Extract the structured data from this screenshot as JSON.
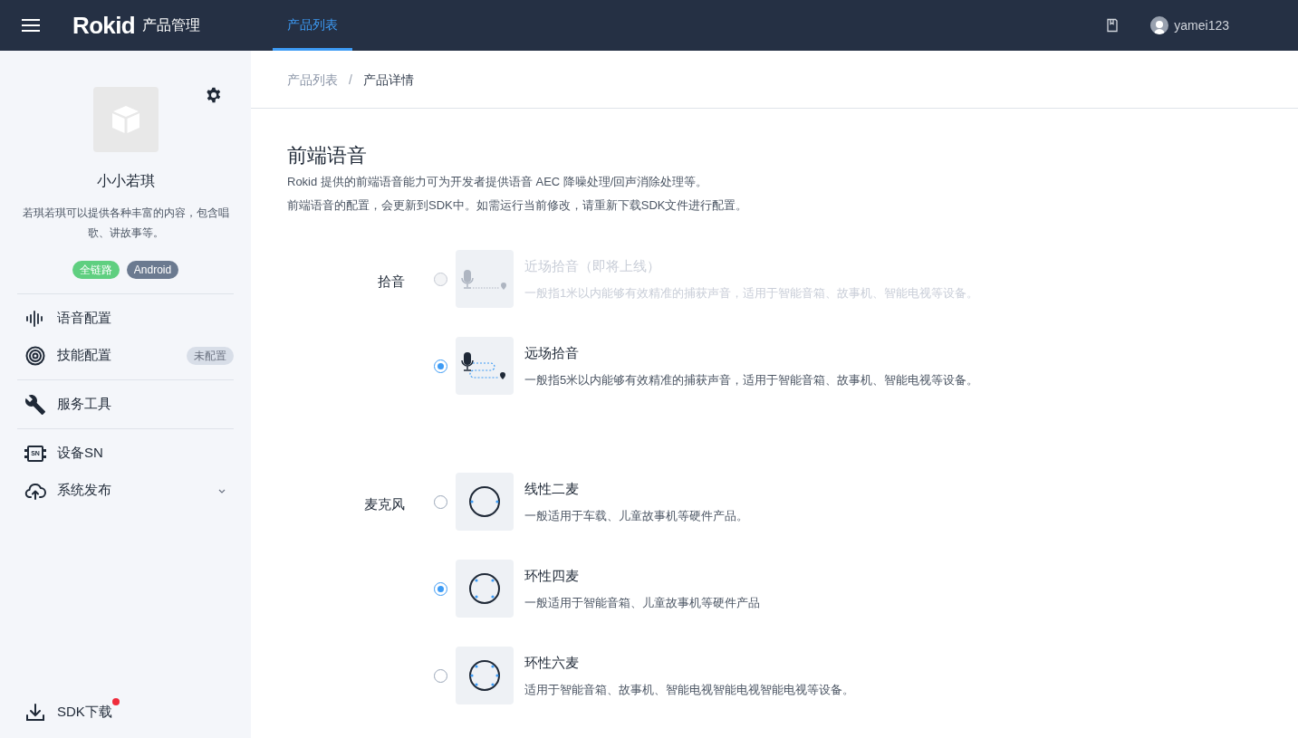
{
  "header": {
    "logo": "Rokid",
    "app_title": "产品管理",
    "tabs": [
      {
        "label": "产品列表",
        "selected": true
      }
    ],
    "user": "yamei123"
  },
  "sidebar": {
    "product": {
      "name": "小小若琪",
      "description": "若琪若琪可以提供各种丰富的内容，包含唱歌、讲故事等。",
      "tags": [
        {
          "label": "全链路",
          "color": "#5fcf80"
        },
        {
          "label": "Android",
          "color": "#6b7a90"
        }
      ]
    },
    "sections": [
      [
        {
          "kind": "wave",
          "label": "语音配置"
        },
        {
          "kind": "target",
          "label": "技能配置",
          "badge": "未配置"
        }
      ],
      [
        {
          "kind": "wrench",
          "label": "服务工具"
        }
      ],
      [
        {
          "kind": "chip",
          "label": "设备SN",
          "chip_text": "SN"
        },
        {
          "kind": "cloud",
          "label": "系统发布",
          "expandable": true
        }
      ]
    ],
    "footer_item": {
      "label": "SDK下载",
      "notification_dot": true
    }
  },
  "breadcrumb": [
    "产品列表",
    "产品详情"
  ],
  "breadcrumb_separator": "/",
  "page": {
    "title": "前端语音",
    "description": [
      "Rokid 提供的前端语音能力可为开发者提供语音 AEC 降噪处理/回声消除处理等。",
      "前端语音的配置，会更新到SDK中。如需运行当前修改，请重新下载SDK文件进行配置。"
    ],
    "groups": [
      {
        "label": "拾音",
        "options": [
          {
            "kind": "near",
            "title": "近场拾音（即将上线）",
            "description": "一般指1米以内能够有效精准的捕获声音，适用于智能音箱、故事机、智能电视等设备。",
            "selected": false,
            "disabled": true
          },
          {
            "kind": "far",
            "title": "远场拾音",
            "description": "一般指5米以内能够有效精准的捕获声音，适用于智能音箱、故事机、智能电视等设备。",
            "selected": true,
            "disabled": false
          }
        ]
      },
      {
        "label": "麦克风",
        "options": [
          {
            "kind": "mic2",
            "title": "线性二麦",
            "description": "一般适用于车载、儿童故事机等硬件产品。",
            "selected": false,
            "disabled": false
          },
          {
            "kind": "mic4",
            "title": "环性四麦",
            "description": "一般适用于智能音箱、儿童故事机等硬件产品",
            "selected": true,
            "disabled": false
          },
          {
            "kind": "mic6",
            "title": "环性六麦",
            "description": "适用于智能音箱、故事机、智能电视智能电视智能电视等设备。",
            "selected": false,
            "disabled": false
          }
        ]
      }
    ]
  }
}
